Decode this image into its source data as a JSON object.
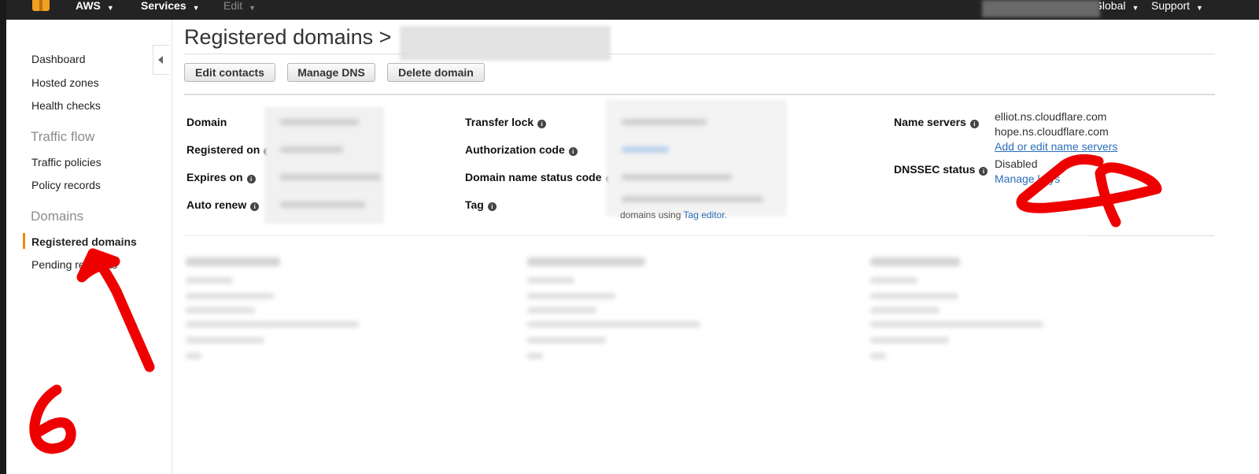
{
  "topnav": {
    "brand": "AWS",
    "services": "Services",
    "edit": "Edit",
    "region": "Global",
    "support": "Support"
  },
  "sidebar": {
    "items": [
      {
        "label": "Dashboard"
      },
      {
        "label": "Hosted zones"
      },
      {
        "label": "Health checks"
      }
    ],
    "traffic_flow": {
      "heading": "Traffic flow",
      "items": [
        {
          "label": "Traffic policies"
        },
        {
          "label": "Policy records"
        }
      ]
    },
    "domains": {
      "heading": "Domains",
      "items": [
        {
          "label": "Registered domains"
        },
        {
          "label": "Pending requests"
        }
      ]
    }
  },
  "main": {
    "title": "Registered domains >",
    "buttons": {
      "edit_contacts": "Edit contacts",
      "manage_dns": "Manage DNS",
      "delete_domain": "Delete domain"
    },
    "details": {
      "domain": "Domain",
      "registered_on": "Registered on",
      "expires_on": "Expires on",
      "auto_renew": "Auto renew",
      "transfer_lock": "Transfer lock",
      "authorization_code": "Authorization code",
      "domain_status_code": "Domain name status code",
      "tag": "Tag",
      "tag_text": "domains using",
      "tag_link": "Tag editor.",
      "name_servers": "Name servers",
      "name_server_values": [
        "elliot.ns.cloudflare.com",
        "hope.ns.cloudflare.com"
      ],
      "edit_name_servers": "Add or edit name servers",
      "dnssec_status": "DNSSEC status",
      "dnssec_value": "Disabled",
      "manage_keys": "Manage keys"
    }
  },
  "annotation": {
    "number": "6",
    "color": "#ee0000"
  }
}
